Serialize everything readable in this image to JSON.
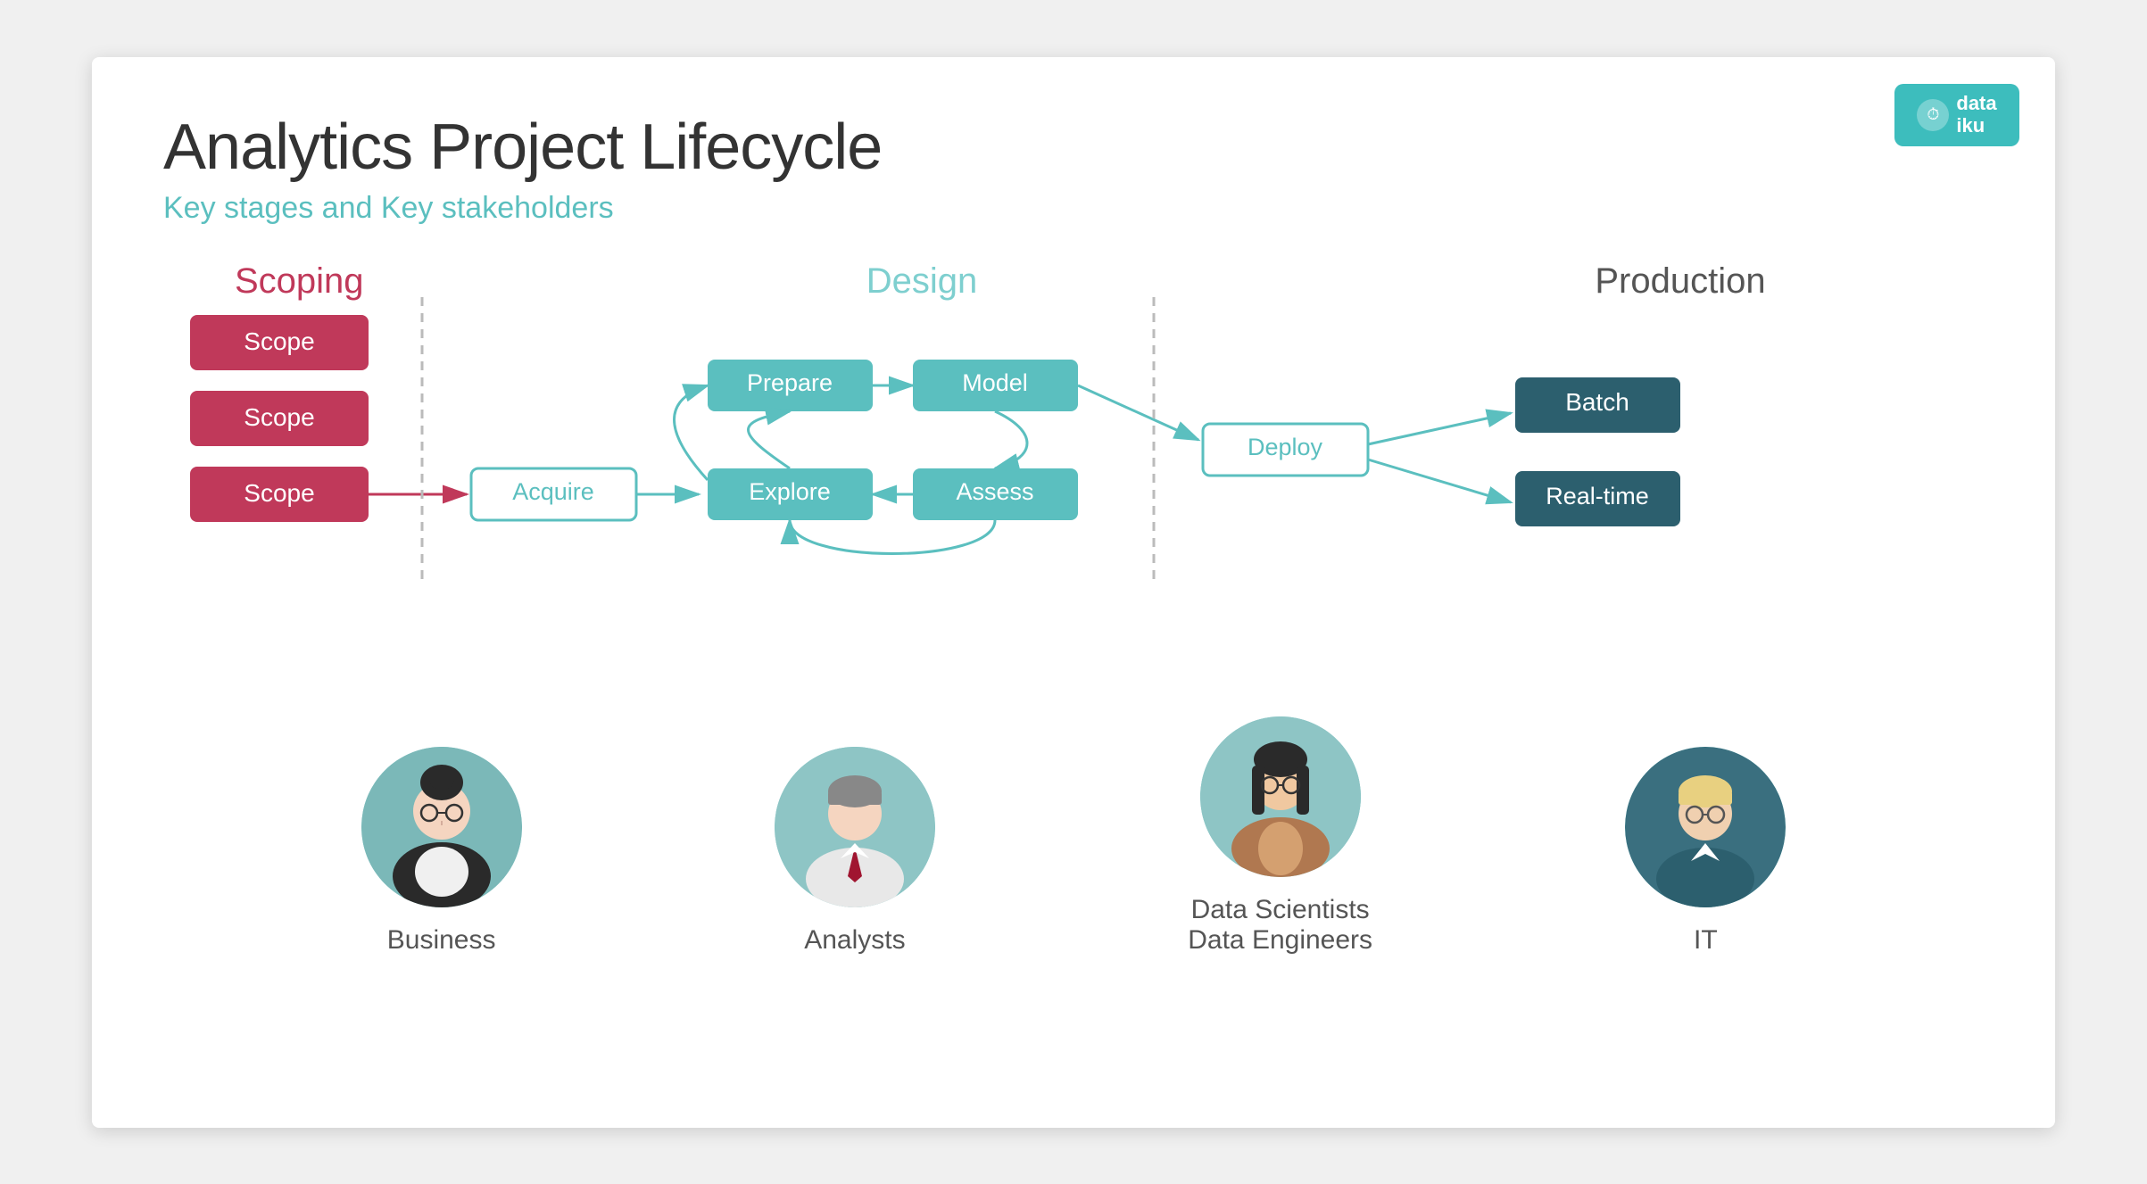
{
  "title": "Analytics Project Lifecycle",
  "subtitle": "Key stages and Key stakeholders",
  "logo": {
    "text1": "data",
    "text2": "iku",
    "icon": "⏱"
  },
  "sections": {
    "scoping": "Scoping",
    "design": "Design",
    "production": "Production"
  },
  "scoping_boxes": [
    "Scope",
    "Scope",
    "Scope"
  ],
  "flow_nodes": {
    "acquire": "Acquire",
    "prepare": "Prepare",
    "explore": "Explore",
    "model": "Model",
    "assess": "Assess",
    "deploy": "Deploy",
    "batch": "Batch",
    "realtime": "Real-time"
  },
  "personas": [
    {
      "name": "Business"
    },
    {
      "name": "Analysts"
    },
    {
      "name": "Data Scientists\nData Engineers"
    },
    {
      "name": "IT"
    }
  ]
}
